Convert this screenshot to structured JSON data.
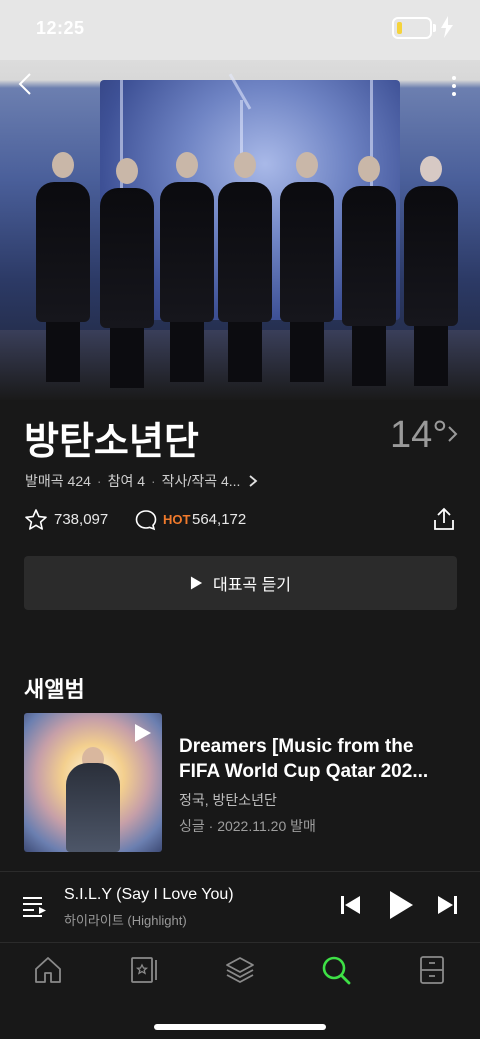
{
  "status_bar": {
    "time": "12:25"
  },
  "artist": {
    "name": "방탄소년단",
    "temperature": "14°",
    "meta": {
      "released": "발매곡 424",
      "participated": "참여 4",
      "composed": "작사/작곡 4..."
    },
    "likes": "738,097",
    "hot_label": "HOT",
    "comments": "564,172"
  },
  "play_top_label": "대표곡 듣기",
  "new_album": {
    "section_title": "새앨범",
    "title": "Dreamers [Music from the FIFA World Cup Qatar 202...",
    "artist": "정국, 방탄소년단",
    "info": "싱글 · 2022.11.20 발매"
  },
  "mini_player": {
    "title": "S.I.L.Y (Say I Love You)",
    "subtitle": "하이라이트 (Highlight)"
  },
  "tabs": [
    {
      "name": "home-icon"
    },
    {
      "name": "storage-icon"
    },
    {
      "name": "layers-icon"
    },
    {
      "name": "search-icon",
      "active": true
    },
    {
      "name": "library-icon"
    }
  ],
  "colors": {
    "accent": "#3ee046",
    "hot": "#f07a2c",
    "background": "#181818",
    "button": "#2b2b2b"
  }
}
